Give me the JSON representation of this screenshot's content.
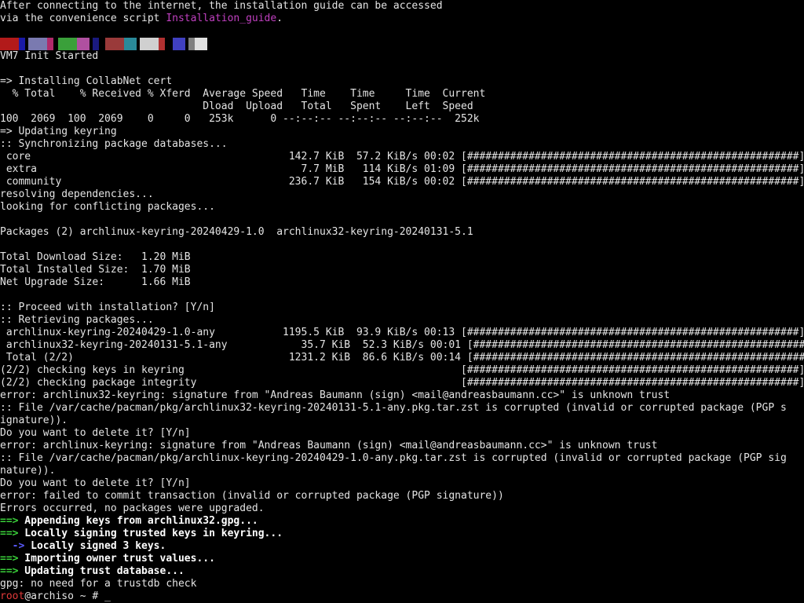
{
  "terminal": {
    "intro_line1": "After connecting to the internet, the installation guide can be accessed",
    "intro_line2_prefix": "via the convenience script ",
    "intro_line2_link": "Installation_guide",
    "intro_line2_suffix": ".",
    "colorbar": [
      "#b21a1a",
      "#1a1aa8",
      "#7a7ab0",
      "#b02a6a",
      "#3aa03a",
      "#b050a0",
      "#1a1a80",
      "#9a3a3a",
      "#2a8a9a",
      "#d0d0d0",
      "#b03030",
      "#4040c0",
      "#808080",
      "#e0e0e0"
    ],
    "vm_init": "VM7 Init Started",
    "blank1": "",
    "collabnet": "=> Installing CollabNet cert",
    "curl_header1": "  % Total    % Received % Xferd  Average Speed   Time    Time     Time  Current",
    "curl_header2": "                                 Dload  Upload   Total   Spent    Left  Speed",
    "curl_row": "100  2069  100  2069    0     0   253k      0 --:--:-- --:--:-- --:--:--  252k",
    "updating_keyring": "=> Updating keyring",
    "sync_db": ":: Synchronizing package databases...",
    "db_core": " core                                          142.7 KiB  57.2 KiB/s 00:02 [######################################################] 100%",
    "db_extra": " extra                                           7.7 MiB   114 KiB/s 01:09 [######################################################] 100%",
    "db_community": " community                                     236.7 KiB   154 KiB/s 00:02 [######################################################] 100%",
    "resolving": "resolving dependencies...",
    "conflicting": "looking for conflicting packages...",
    "blank2": "",
    "packages": "Packages (2) archlinux-keyring-20240429-1.0  archlinux32-keyring-20240131-5.1",
    "blank3": "",
    "total_download": "Total Download Size:   1.20 MiB",
    "total_installed": "Total Installed Size:  1.70 MiB",
    "net_upgrade": "Net Upgrade Size:      1.66 MiB",
    "blank4": "",
    "proceed": ":: Proceed with installation? [Y/n]",
    "retrieving": ":: Retrieving packages...",
    "pkg1": " archlinux-keyring-20240429-1.0-any           1195.5 KiB  93.9 KiB/s 00:13 [######################################################] 100%",
    "pkg2": " archlinux32-keyring-20240131-5.1-any            35.7 KiB  52.3 KiB/s 00:01 [######################################################] 100%",
    "pkg_total": " Total (2/2)                                   1231.2 KiB  86.6 KiB/s 00:14 [######################################################] 100%",
    "check_keys": "(2/2) checking keys in keyring                                             [######################################################] 100%",
    "check_integrity": "(2/2) checking package integrity                                           [######################################################] 100%",
    "error1": "error: archlinux32-keyring: signature from \"Andreas Baumann (sign) <mail@andreasbaumann.cc>\" is unknown trust",
    "file1a": ":: File /var/cache/pacman/pkg/archlinux32-keyring-20240131-5.1-any.pkg.tar.zst is corrupted (invalid or corrupted package (PGP s",
    "file1b": "ignature)).",
    "delete1": "Do you want to delete it? [Y/n]",
    "error2": "error: archlinux-keyring: signature from \"Andreas Baumann (sign) <mail@andreasbaumann.cc>\" is unknown trust",
    "file2a": ":: File /var/cache/pacman/pkg/archlinux-keyring-20240429-1.0-any.pkg.tar.zst is corrupted (invalid or corrupted package (PGP sig",
    "file2b": "nature)).",
    "delete2": "Do you want to delete it? [Y/n]",
    "error3": "error: failed to commit transaction (invalid or corrupted package (PGP signature))",
    "errors_occurred": "Errors occurred, no packages were upgraded.",
    "arrow": "==>",
    "sub_arrow": "  ->",
    "appending": " Appending keys from archlinux32.gpg...",
    "signing": " Locally signing trusted keys in keyring...",
    "signed": " Locally signed 3 keys.",
    "importing": " Importing owner trust values...",
    "updating_trust": " Updating trust database...",
    "gpg": "gpg: no need for a trustdb check",
    "prompt_user": "root",
    "prompt_host": "@archiso",
    "prompt_rest": " ~ # ",
    "cursor": "_"
  }
}
